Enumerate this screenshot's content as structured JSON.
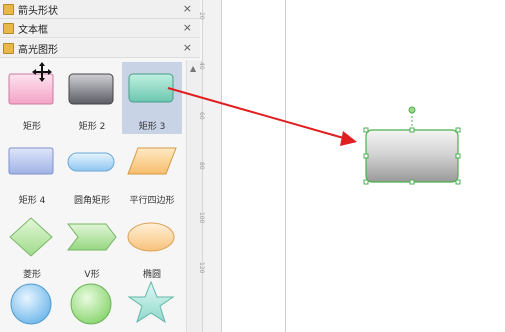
{
  "library": {
    "sections": [
      {
        "title": "箭头形状",
        "close": "×"
      },
      {
        "title": "文本框",
        "close": "×"
      },
      {
        "title": "高光图形",
        "close": "×"
      }
    ],
    "shapes": [
      {
        "label": "矩形"
      },
      {
        "label": "矩形 2"
      },
      {
        "label": "矩形 3"
      },
      {
        "label": "矩形 4"
      },
      {
        "label": "圆角矩形"
      },
      {
        "label": "平行四边形"
      },
      {
        "label": "菱形"
      },
      {
        "label": "V形"
      },
      {
        "label": "椭圆"
      }
    ],
    "selected_shape": "矩形 3"
  },
  "ruler": {
    "ticks": [
      "20",
      "40",
      "60",
      "80",
      "100",
      "120"
    ]
  },
  "colors": {
    "arrow": "#e02020",
    "selection": "#4caf50",
    "selected_cell": "#c9d3e6"
  }
}
